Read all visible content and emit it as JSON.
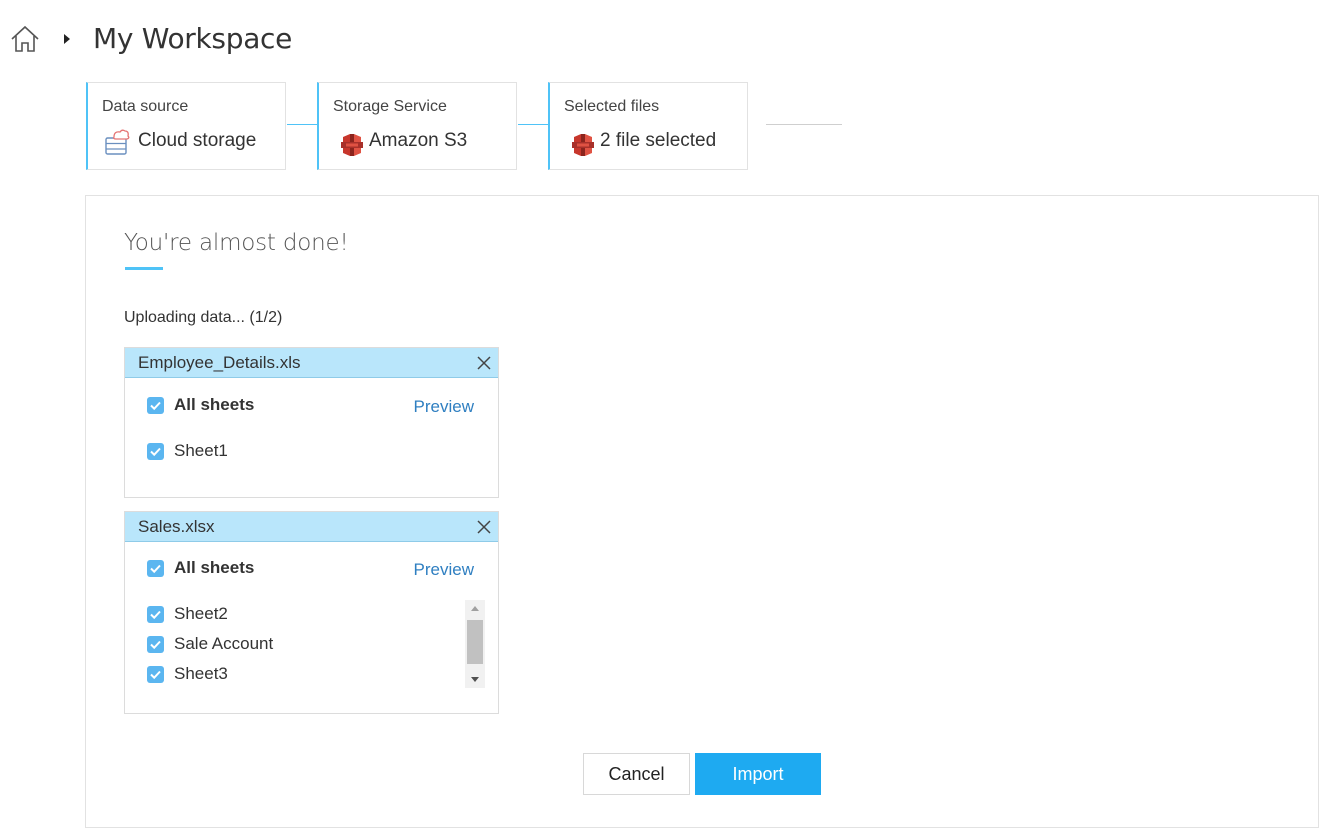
{
  "header": {
    "title": "My Workspace"
  },
  "steps": [
    {
      "label": "Data source",
      "value": "Cloud storage",
      "icon": "cloud-storage-icon"
    },
    {
      "label": "Storage Service",
      "value": "Amazon S3",
      "icon": "amazon-s3-icon"
    },
    {
      "label": "Selected files",
      "value": "2 file selected",
      "icon": "amazon-s3-icon"
    }
  ],
  "panel": {
    "title": "You're almost done!",
    "status": "Uploading data... (1/2)"
  },
  "files": [
    {
      "name": "Employee_Details.xls",
      "all_sheets_label": "All sheets",
      "preview_label": "Preview",
      "sheets": [
        "Sheet1"
      ]
    },
    {
      "name": "Sales.xlsx",
      "all_sheets_label": "All sheets",
      "preview_label": "Preview",
      "sheets": [
        "Sheet2",
        "Sale Account",
        "Sheet3"
      ]
    }
  ],
  "buttons": {
    "cancel": "Cancel",
    "import": "Import"
  },
  "colors": {
    "accent": "#4fc3f7",
    "primary_button": "#1eaaf1",
    "checkbox": "#5bb6f0",
    "file_header": "#b9e6fb",
    "link": "#2f7fc1"
  }
}
